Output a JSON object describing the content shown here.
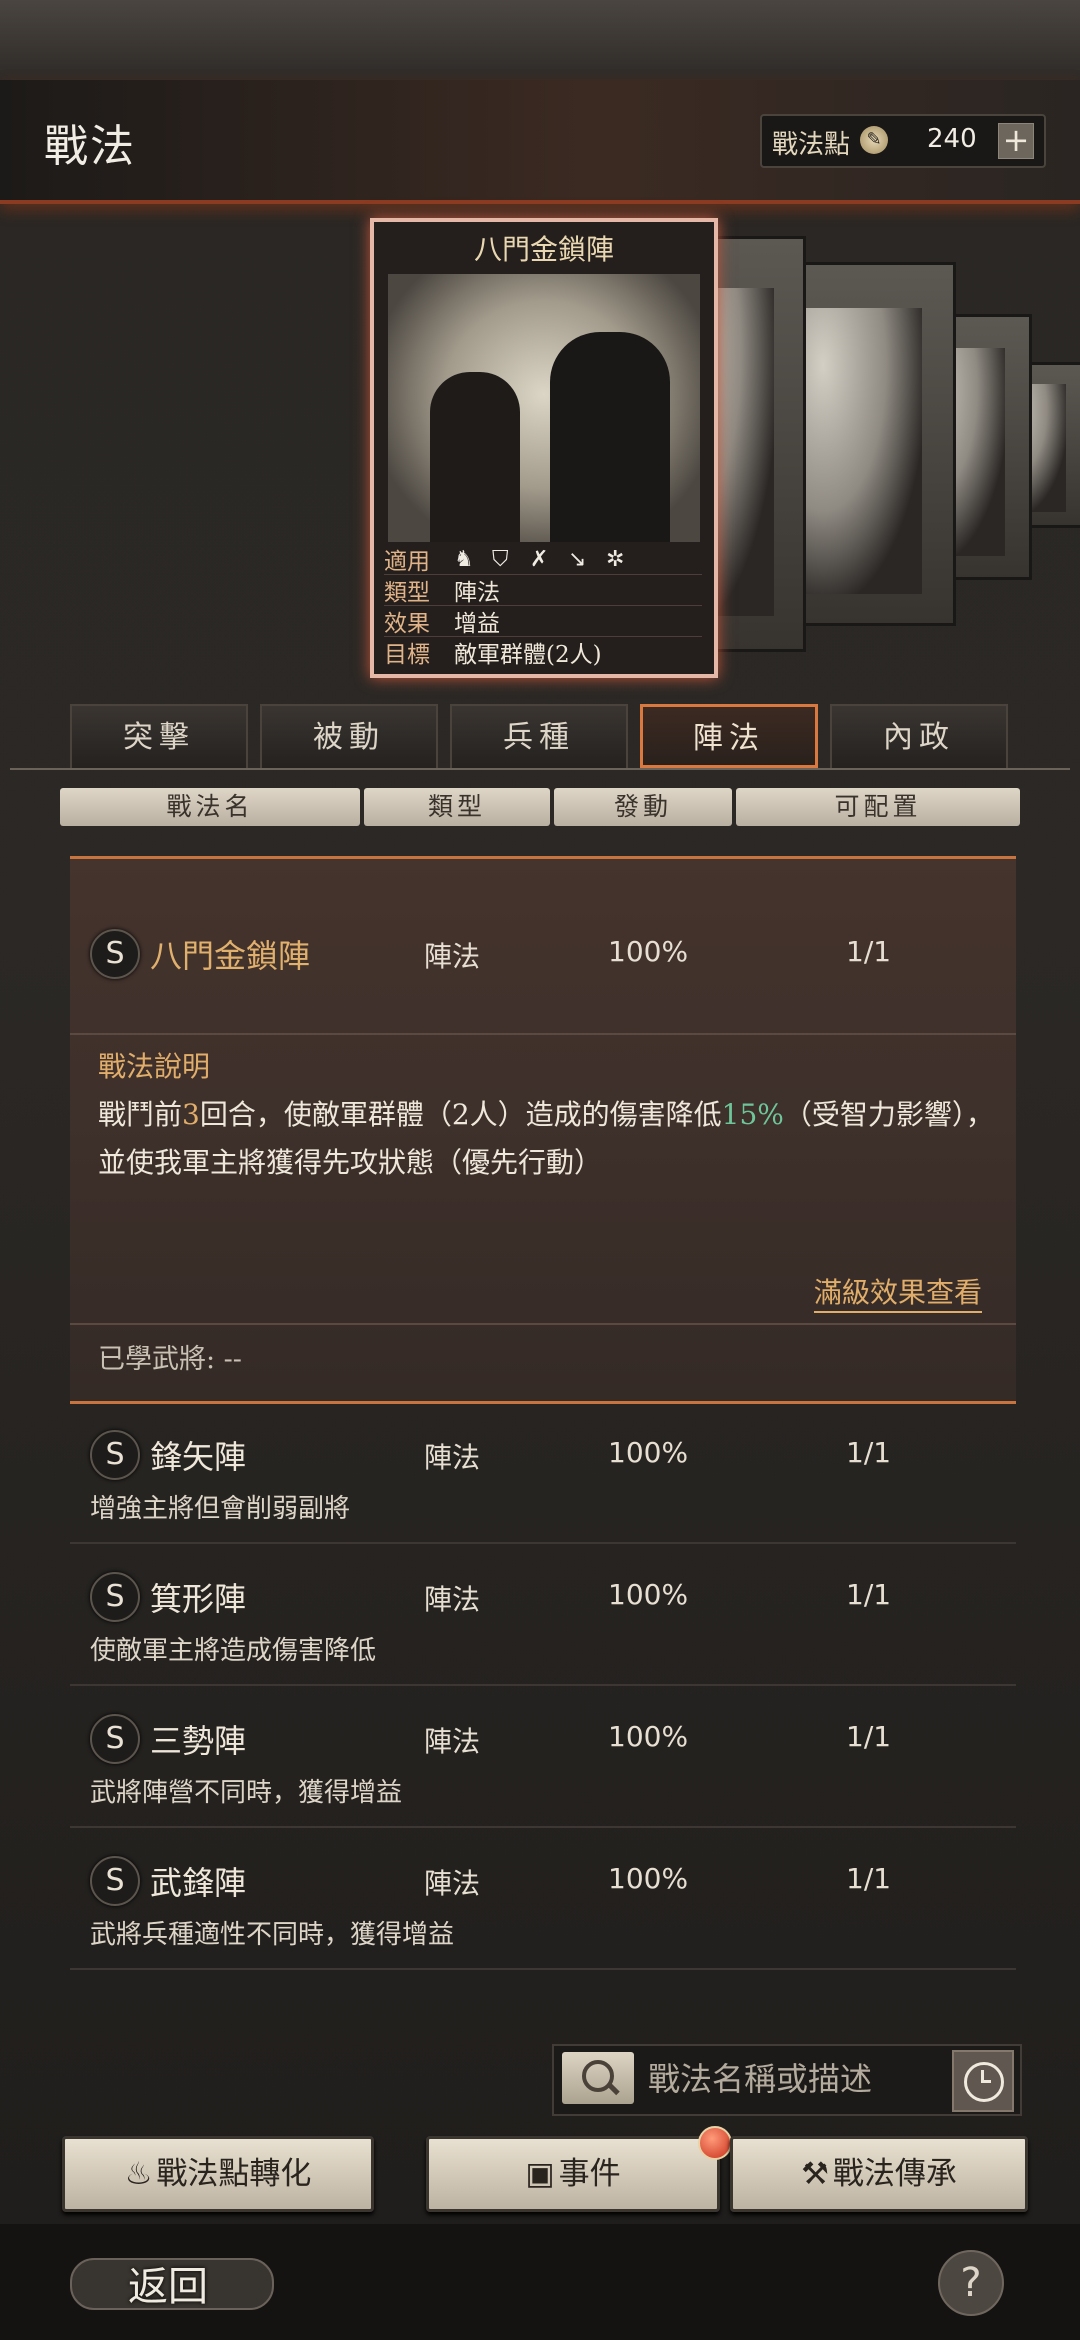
{
  "header": {
    "title": "戰法",
    "points_label": "戰法點",
    "points_value": "240",
    "plus": "+",
    "coin_icon": "coin-icon"
  },
  "card": {
    "name": "八門金鎖陣",
    "rows": [
      {
        "key": "適用",
        "value": ""
      },
      {
        "key": "類型",
        "value": "陣法"
      },
      {
        "key": "效果",
        "value": "增益"
      },
      {
        "key": "目標",
        "value": "敵軍群體(2人)"
      }
    ],
    "unit_icons": [
      "cavalry-icon",
      "shield-icon",
      "archer-icon",
      "spear-icon",
      "siege-icon"
    ]
  },
  "tabs": [
    {
      "label": "突擊",
      "active": false
    },
    {
      "label": "被動",
      "active": false
    },
    {
      "label": "兵種",
      "active": false
    },
    {
      "label": "陣法",
      "active": true
    },
    {
      "label": "內政",
      "active": false
    }
  ],
  "columns": [
    "戰法名",
    "類型",
    "發動",
    "可配置"
  ],
  "expanded": {
    "grade": "S",
    "name": "八門金鎖陣",
    "type": "陣法",
    "rate": "100%",
    "slots": "1/1",
    "desc_title": "戰法說明",
    "desc_a": "戰鬥前",
    "desc_num": "3",
    "desc_b": "回合，使敵軍群體（2人）造成的傷害降低",
    "desc_pct": "15%",
    "desc_c": "（受智力影響），並使我軍主將獲得先攻狀態（優先行動）",
    "full_link": "滿級效果查看",
    "learned": "已學武將: --"
  },
  "items": [
    {
      "grade": "S",
      "name": "鋒矢陣",
      "type": "陣法",
      "rate": "100%",
      "slots": "1/1",
      "desc": "增強主將但會削弱副將"
    },
    {
      "grade": "S",
      "name": "箕形陣",
      "type": "陣法",
      "rate": "100%",
      "slots": "1/1",
      "desc": "使敵軍主將造成傷害降低"
    },
    {
      "grade": "S",
      "name": "三勢陣",
      "type": "陣法",
      "rate": "100%",
      "slots": "1/1",
      "desc": "武將陣營不同時，獲得增益"
    },
    {
      "grade": "S",
      "name": "武鋒陣",
      "type": "陣法",
      "rate": "100%",
      "slots": "1/1",
      "desc": "武將兵種適性不同時，獲得增益"
    }
  ],
  "search": {
    "placeholder": "戰法名稱或描述"
  },
  "buttons": {
    "convert": "戰法點轉化",
    "events": "事件",
    "inherit": "戰法傳承"
  },
  "footer": {
    "back": "返回",
    "help": "?"
  }
}
